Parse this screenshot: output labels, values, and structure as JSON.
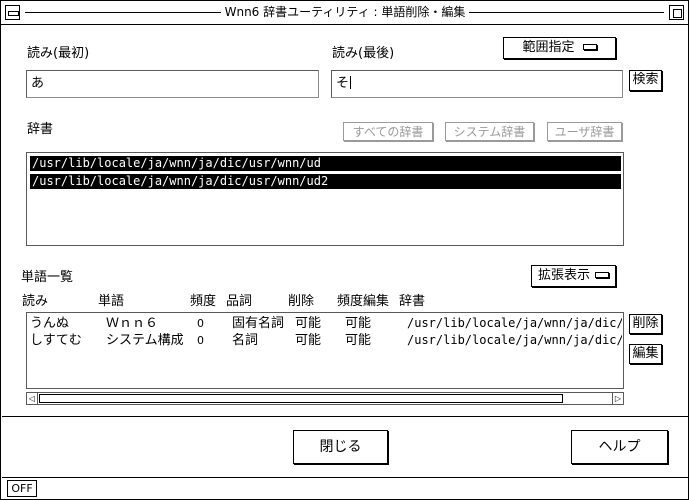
{
  "window": {
    "title": "Wnn6 辞書ユーティリティ : 単語削除・編集"
  },
  "reading_start": {
    "label": "読み(最初)",
    "value": "あ"
  },
  "reading_end": {
    "label": "読み(最後)",
    "value": "そ"
  },
  "range_button": {
    "label": "範囲指定"
  },
  "search_button": {
    "label": "検索"
  },
  "dictionary": {
    "label": "辞書",
    "all_button": "すべての辞書",
    "system_button": "システム辞書",
    "user_button": "ユーザ辞書",
    "items": [
      "/usr/lib/locale/ja/wnn/ja/dic/usr/wnn/ud",
      "/usr/lib/locale/ja/wnn/ja/dic/usr/wnn/ud2"
    ]
  },
  "word_list": {
    "label": "単語一覧",
    "expand_button": "拡張表示",
    "columns": [
      "読み",
      "単語",
      "頻度",
      "品詞",
      "削除",
      "頻度編集",
      "辞書"
    ],
    "rows": [
      [
        "うんぬ",
        "Ｗｎｎ６",
        "0",
        "固有名詞",
        "可能",
        "可能",
        "/usr/lib/locale/ja/wnn/ja/dic/u"
      ],
      [
        "しすてむ",
        "システム構成",
        "0",
        "名詞",
        "可能",
        "可能",
        "/usr/lib/locale/ja/wnn/ja/dic/u"
      ]
    ],
    "delete_button": "削除",
    "edit_button": "編集"
  },
  "footer": {
    "close_button": "閉じる",
    "help_button": "ヘルプ",
    "status": "OFF"
  }
}
